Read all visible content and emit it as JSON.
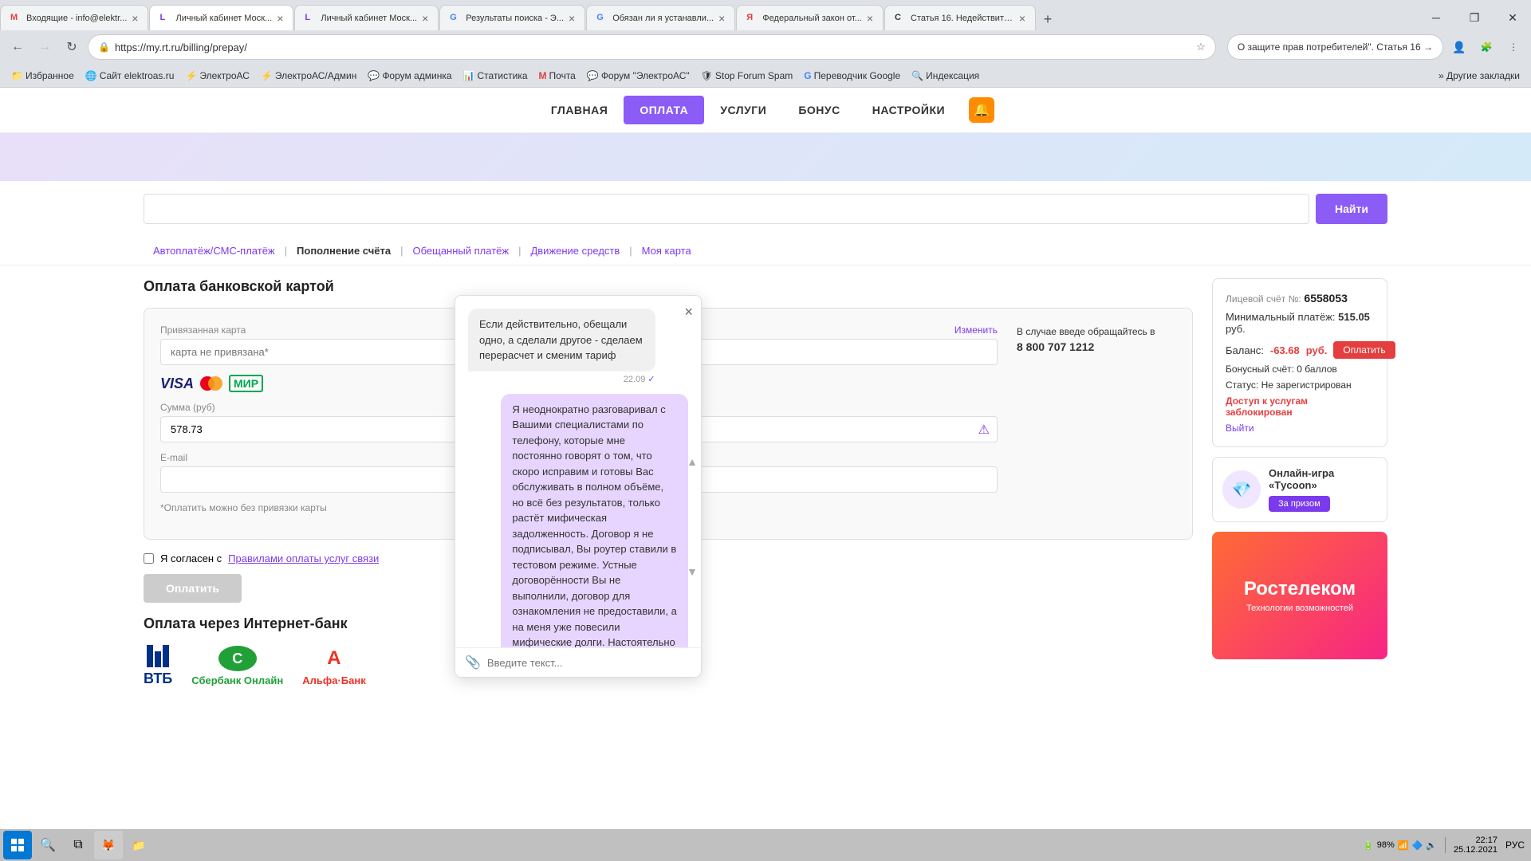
{
  "browser": {
    "tabs": [
      {
        "id": "tab1",
        "title": "Входящие - info@elektr...",
        "active": false,
        "favicon": "M"
      },
      {
        "id": "tab2",
        "title": "Личный кабинет Моск...",
        "active": true,
        "favicon": "L"
      },
      {
        "id": "tab3",
        "title": "Личный кабинет Моск...",
        "active": false,
        "favicon": "L"
      },
      {
        "id": "tab4",
        "title": "Результаты поиска - Э...",
        "active": false,
        "favicon": "G"
      },
      {
        "id": "tab5",
        "title": "Обязан ли я устанавли...",
        "active": false,
        "favicon": "G"
      },
      {
        "id": "tab6",
        "title": "Федеральный закон от...",
        "active": false,
        "favicon": "Я"
      },
      {
        "id": "tab7",
        "title": "Статья 16. Недействите...",
        "active": false,
        "favicon": "С"
      }
    ],
    "url": "https://my.rt.ru/billing/prepay/",
    "search_suggestion": "О защите прав потребителей\". Статья 16  →"
  },
  "bookmarks": [
    {
      "label": "Избранное",
      "icon": "★"
    },
    {
      "label": "Сайт elektroas.ru",
      "icon": "🌐"
    },
    {
      "label": "ЭлектроАС",
      "icon": "⚡"
    },
    {
      "label": "ЭлектроАС/Админ",
      "icon": "⚡"
    },
    {
      "label": "Форум админка",
      "icon": "💬"
    },
    {
      "label": "Статистика",
      "icon": "📊"
    },
    {
      "label": "Почта",
      "icon": "M"
    },
    {
      "label": "Форум \"ЭлектроАС\"",
      "icon": "💬"
    },
    {
      "label": "Stop Forum Spam",
      "icon": "🛡"
    },
    {
      "label": "Переводчик Google",
      "icon": "G"
    },
    {
      "label": "Индексация",
      "icon": "🔍"
    }
  ],
  "nav": {
    "items": [
      {
        "label": "ГЛАВНАЯ",
        "active": false
      },
      {
        "label": "ОПЛАТА",
        "active": true
      },
      {
        "label": "УСЛУГИ",
        "active": false
      },
      {
        "label": "БОНУС",
        "active": false
      },
      {
        "label": "НАСТРОЙКИ",
        "active": false
      }
    ]
  },
  "search": {
    "placeholder": "",
    "button_label": "Найти"
  },
  "sub_nav": {
    "items": [
      {
        "label": "Автоплатёж/СМС-платёж",
        "active": false
      },
      {
        "label": "Пополнение счёта",
        "active": true
      },
      {
        "label": "Обещанный платёж",
        "active": false
      },
      {
        "label": "Движение средств",
        "active": false
      },
      {
        "label": "Моя карта",
        "active": false
      }
    ]
  },
  "payment_section": {
    "title": "Оплата банковской картой",
    "card_label": "Привязанная карта",
    "change_label": "Изменить",
    "card_placeholder": "карта не привязана*",
    "amount_label": "Сумма (руб)",
    "amount_value": "578.73",
    "email_label": "E-mail",
    "email_placeholder": "",
    "note": "*Оплатить можно без привязки карты",
    "call_text": "В случае введе обращайтесь в",
    "phone": "8 800 707 1212",
    "checkbox_text": "Я согласен с ",
    "checkbox_link": "Правилами оплаты услуг связи",
    "pay_button": "Оплатить"
  },
  "internet_bank": {
    "title": "Оплата через Интернет-банк"
  },
  "account": {
    "label": "Лицевой счёт №:",
    "number": "6558053",
    "min_payment_label": "Минимальный платёж:",
    "min_payment": "515.05",
    "min_payment_unit": "руб.",
    "balance_label": "Баланс:",
    "balance": "-63.68",
    "balance_unit": "руб.",
    "pay_button": "Оплатить",
    "bonus_label": "Бонусный счёт:",
    "bonus_value": "0 баллов",
    "status_label": "Статус:",
    "status_value": "Не зарегистрирован",
    "access_blocked": "Доступ к услугам заблокирован",
    "logout": "Выйти"
  },
  "ad": {
    "title": "Онлайн-игра «Тycoon»",
    "button": "За призом"
  },
  "chat": {
    "close_btn": "×",
    "messages": [
      {
        "side": "left",
        "text": "Если действительно, обещали одно, а сделали другое - сделаем перерасчет и сменим тариф",
        "time": "22.09",
        "seen": true
      },
      {
        "side": "right",
        "text": "Я неоднократно разговаривал с Вашими специалистами по телефону, которые мне постоянно говорят о том, что скоро исправим и готовы Вас обслуживать в полном объёме, но всё без результатов, только растёт мифическая задолженность. Договор я не подписывал, Вы роутер ставили в тестовом режиме. Устные договорённости Вы не выполнили, договор для ознакомления не предоставили, а на меня уже повесили мифические долги. Настоятельно прошу Вас предоставить мне почтовый адрес для отправки роутера по почте.",
        "time": ""
      }
    ],
    "input_placeholder": "Введите текст..."
  },
  "taskbar": {
    "time": "22:17",
    "date": "25.12.2021",
    "battery": "98%"
  },
  "banks": [
    {
      "name": "ВТБ",
      "color": "#003087"
    },
    {
      "name": "Сбербанк Онлайн",
      "color": "#21a038"
    },
    {
      "name": "Альфа·Банк",
      "color": "#ef3124"
    }
  ]
}
